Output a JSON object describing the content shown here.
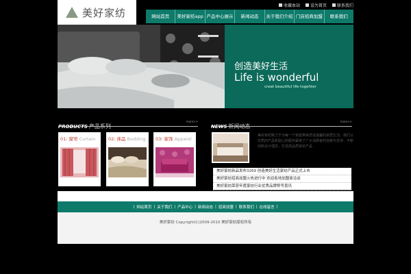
{
  "brand": {
    "name": "美好家纺"
  },
  "top_links": [
    "收藏本站",
    "设为首页",
    "联系我们"
  ],
  "nav": [
    "网站首页",
    "美好家纺app",
    "产品中心展示",
    "新闻动态",
    "关于我们介绍",
    "门店招商加盟",
    "联系我们"
  ],
  "banner": {
    "line1": "创造美好生活",
    "line2": "Life is wonderful",
    "line3": "creat beautiful life togehter"
  },
  "products_section": {
    "en": "PRODUCTS",
    "cn": "产品系列",
    "more": "more>>"
  },
  "news_section": {
    "en": "NEWS",
    "cn": "新闻动态",
    "more": "more>>"
  },
  "products": [
    {
      "num": "01",
      "cn": "窗帘",
      "en": "Curtain"
    },
    {
      "num": "02",
      "cn": "床品",
      "en": "Bedding"
    },
    {
      "num": "03",
      "cn": "家饰",
      "en": "Apparel"
    }
  ],
  "news_paragraph": "美好家纺致力于为每一个家庭带来舒适温馨的家居生活，我们以优质的产品和贴心的服务赢得了广大消费者的信赖与支持，不断创新设计理念，打造高品质家纺产品",
  "news_more": "更多",
  "news_list": [
    "美好家纺新品发布3269 创造美好生活家纺产品正式上市",
    "美好家纺招商加盟火热进行中 欢迎各地加盟商洽谈",
    "美好家纺荣获年度家纺行业优秀品牌称号喜讯"
  ],
  "footer_links": [
    "网站首页",
    "关于我们",
    "产品中心",
    "新闻动态",
    "招商加盟",
    "联系我们",
    "在线留言"
  ],
  "copyright": "美好家纺 Copyright(C)2009-2010 美好家纺版权所有",
  "colors": {
    "accent": "#0e7a6a",
    "background": "#000000"
  }
}
